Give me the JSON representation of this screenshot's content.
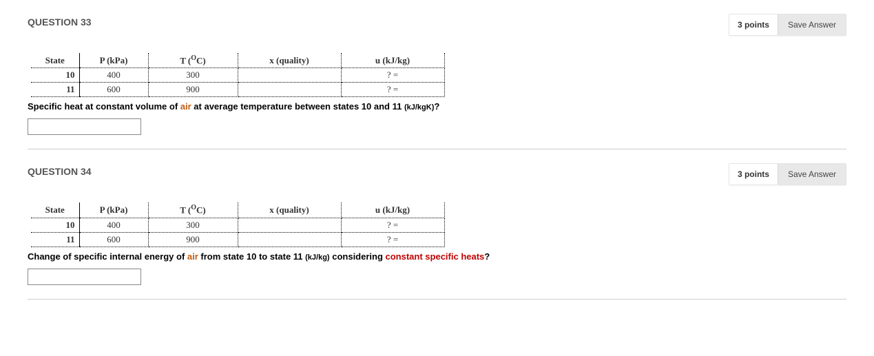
{
  "questions": [
    {
      "number": "QUESTION 33",
      "points": "3 points",
      "save": "Save Answer",
      "table": {
        "hState": "State",
        "hP": "P (kPa)",
        "hT_pre": "T (",
        "hT_sup": "O",
        "hT_post": "C)",
        "hX": "x (quality)",
        "hU": "u (kJ/kg)",
        "rows": [
          {
            "state": "10",
            "p": "400",
            "t": "300",
            "x": "",
            "u": "? ="
          },
          {
            "state": "11",
            "p": "600",
            "t": "900",
            "x": "",
            "u": "? ="
          }
        ]
      },
      "prompt": {
        "p1": "Specific heat at constant volume of ",
        "accent1": "air",
        "p2": " at average temperature between states 10 and 11 ",
        "smallunit": "(kJ/kgK)",
        "p3": "?"
      },
      "input_value": ""
    },
    {
      "number": "QUESTION 34",
      "points": "3 points",
      "save": "Save Answer",
      "table": {
        "hState": "State",
        "hP": "P (kPa)",
        "hT_pre": "T (",
        "hT_sup": "O",
        "hT_post": "C)",
        "hX": "x (quality)",
        "hU": "u (kJ/kg)",
        "rows": [
          {
            "state": "10",
            "p": "400",
            "t": "300",
            "x": "",
            "u": "? ="
          },
          {
            "state": "11",
            "p": "600",
            "t": "900",
            "x": "",
            "u": "? ="
          }
        ]
      },
      "prompt": {
        "p1": "Change of specific internal energy of ",
        "accent1": "air",
        "p2": " from state 10 to state 11 ",
        "smallunit": "(kJ/kg)",
        "p3": " considering ",
        "accent2": "constant specific heats",
        "p4": "?"
      },
      "input_value": ""
    }
  ]
}
